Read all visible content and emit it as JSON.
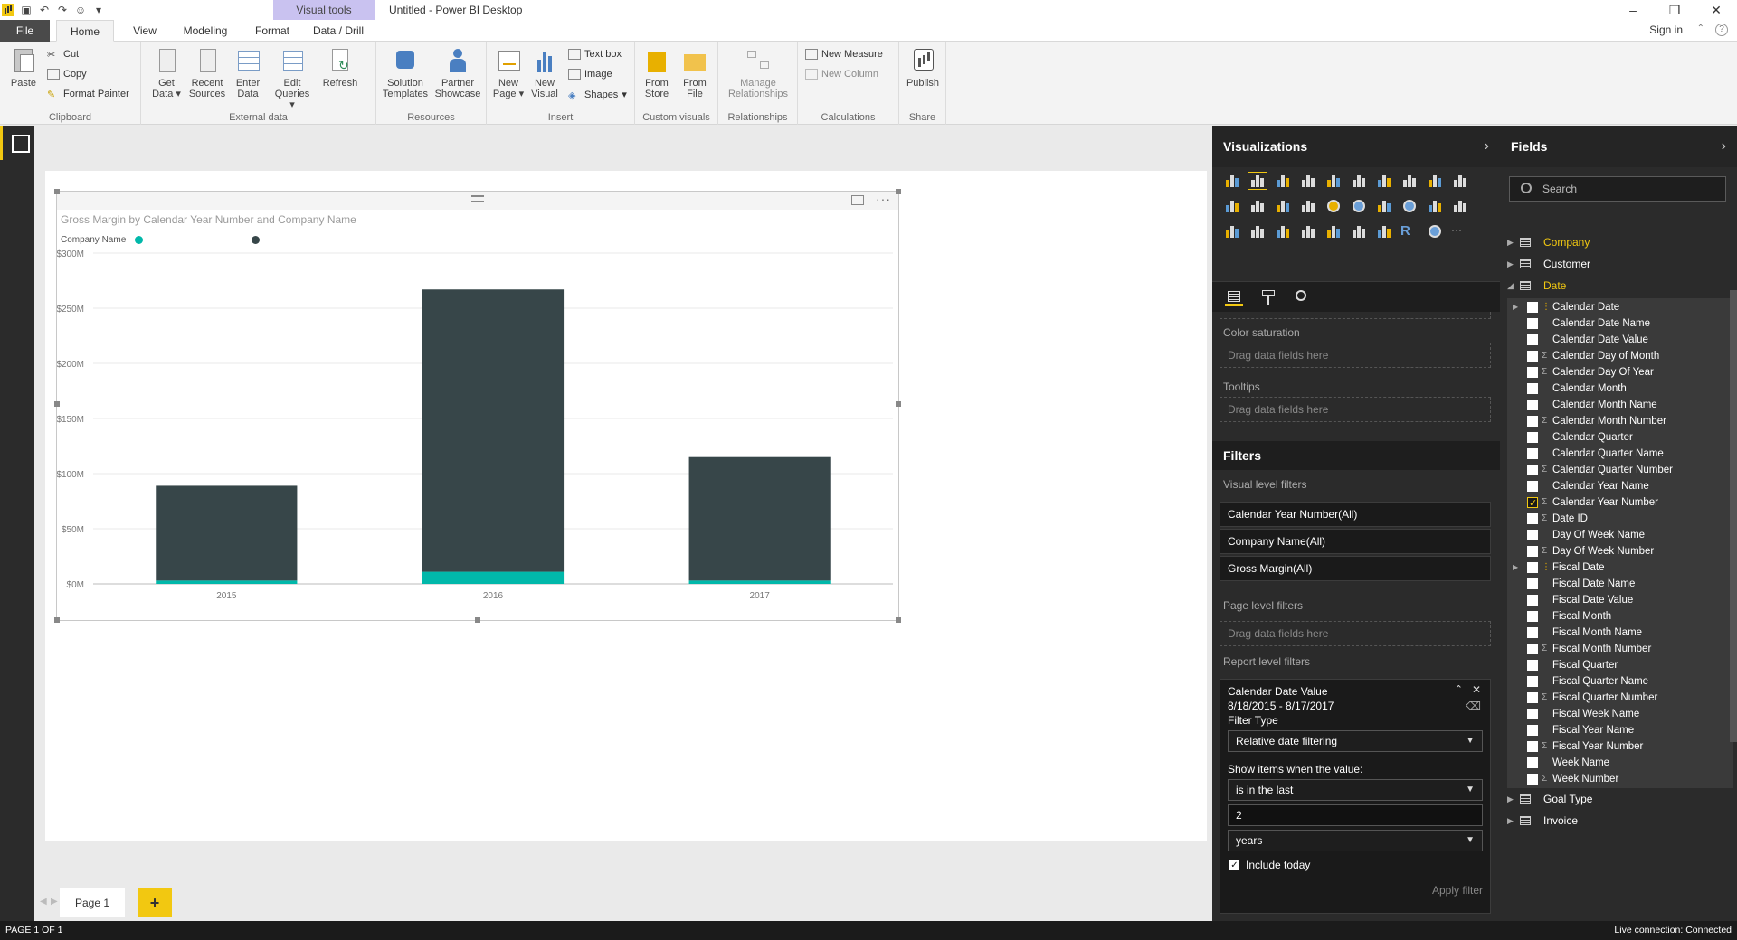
{
  "window": {
    "title": "Untitled - Power BI Desktop",
    "context_tab_group": "Visual tools",
    "signin": "Sign in"
  },
  "tabs": [
    "File",
    "Home",
    "View",
    "Modeling",
    "Format",
    "Data / Drill"
  ],
  "ribbon": {
    "clipboard": {
      "paste": "Paste",
      "cut": "Cut",
      "copy": "Copy",
      "format_painter": "Format Painter",
      "label": "Clipboard"
    },
    "external_data": {
      "get_data": "Get Data",
      "recent_sources": "Recent Sources",
      "enter_data": "Enter Data",
      "edit_queries": "Edit Queries",
      "refresh": "Refresh",
      "label": "External data"
    },
    "resources": {
      "solution_templates": "Solution Templates",
      "partner_showcase": "Partner Showcase",
      "label": "Resources"
    },
    "insert": {
      "new_page": "New Page",
      "new_visual": "New Visual",
      "text_box": "Text box",
      "image": "Image",
      "shapes": "Shapes",
      "label": "Insert"
    },
    "custom_visuals": {
      "from_store": "From Store",
      "from_file": "From File",
      "label": "Custom visuals"
    },
    "relationships": {
      "manage": "Manage Relationships",
      "label": "Relationships"
    },
    "calculations": {
      "new_measure": "New Measure",
      "new_column": "New Column",
      "label": "Calculations"
    },
    "share": {
      "publish": "Publish",
      "label": "Share"
    }
  },
  "chart_data": {
    "type": "bar",
    "stacked": true,
    "title": "Gross Margin by Calendar Year Number and Company Name",
    "legend_title": "Company Name",
    "legend_position": "top-left",
    "categories": [
      "2015",
      "2016",
      "2017"
    ],
    "series": [
      {
        "values": [
          3,
          11,
          3
        ],
        "color": "#01b8aa"
      },
      {
        "values": [
          86,
          256,
          112
        ],
        "color": "#374649"
      }
    ],
    "ylim": [
      0,
      300
    ],
    "yticks": [
      "$0M",
      "$50M",
      "$100M",
      "$150M",
      "$200M",
      "$250M",
      "$300M"
    ],
    "grid": true
  },
  "visualizations": {
    "header": "Visualizations",
    "wells": [
      {
        "label": "Color saturation",
        "placeholder": "Drag data fields here"
      },
      {
        "label": "Tooltips",
        "placeholder": "Drag data fields here"
      }
    ]
  },
  "filters": {
    "header": "Filters",
    "visual_level_label": "Visual level filters",
    "visual_level": [
      "Calendar Year Number(All)",
      "Company Name(All)",
      "Gross Margin(All)"
    ],
    "page_level_label": "Page level filters",
    "page_level_placeholder": "Drag data fields here",
    "report_level_label": "Report level filters",
    "report_card": {
      "field": "Calendar Date Value",
      "range": "8/18/2015 - 8/17/2017",
      "filter_type_label": "Filter Type",
      "filter_type": "Relative date filtering",
      "show_items_label": "Show items when the value:",
      "condition": "is in the last",
      "amount": "2",
      "unit": "years",
      "include_today": "Include today",
      "apply": "Apply filter"
    }
  },
  "fields": {
    "header": "Fields",
    "search_placeholder": "Search",
    "tables": [
      {
        "name": "Company",
        "color": "#f2c811"
      },
      {
        "name": "Customer",
        "color": "#ffffff"
      },
      {
        "name": "Date",
        "color": "#f2c811"
      }
    ],
    "date_fields": [
      {
        "name": "Calendar Date",
        "hier": true
      },
      {
        "name": "Calendar Date Name"
      },
      {
        "name": "Calendar Date Value"
      },
      {
        "name": "Calendar Day of Month",
        "sigma": true
      },
      {
        "name": "Calendar Day Of Year",
        "sigma": true
      },
      {
        "name": "Calendar Month"
      },
      {
        "name": "Calendar Month Name"
      },
      {
        "name": "Calendar Month Number",
        "sigma": true
      },
      {
        "name": "Calendar Quarter"
      },
      {
        "name": "Calendar Quarter Name"
      },
      {
        "name": "Calendar Quarter Number",
        "sigma": true
      },
      {
        "name": "Calendar Year Name"
      },
      {
        "name": "Calendar Year Number",
        "sigma": true,
        "checked": true
      },
      {
        "name": "Date ID",
        "sigma": true
      },
      {
        "name": "Day Of Week Name"
      },
      {
        "name": "Day Of Week Number",
        "sigma": true
      },
      {
        "name": "Fiscal Date",
        "hier": true
      },
      {
        "name": "Fiscal Date Name"
      },
      {
        "name": "Fiscal Date Value"
      },
      {
        "name": "Fiscal Month"
      },
      {
        "name": "Fiscal Month Name"
      },
      {
        "name": "Fiscal Month Number",
        "sigma": true
      },
      {
        "name": "Fiscal Quarter"
      },
      {
        "name": "Fiscal Quarter Name"
      },
      {
        "name": "Fiscal Quarter Number",
        "sigma": true
      },
      {
        "name": "Fiscal Week Name"
      },
      {
        "name": "Fiscal Year Name"
      },
      {
        "name": "Fiscal Year Number",
        "sigma": true
      },
      {
        "name": "Week Name"
      },
      {
        "name": "Week Number",
        "sigma": true
      }
    ],
    "after_tables": [
      {
        "name": "Goal Type"
      },
      {
        "name": "Invoice"
      }
    ]
  },
  "pages": {
    "current": "Page 1",
    "add": "+"
  },
  "status": {
    "left": "PAGE 1 OF 1",
    "right": "Live connection: Connected"
  }
}
